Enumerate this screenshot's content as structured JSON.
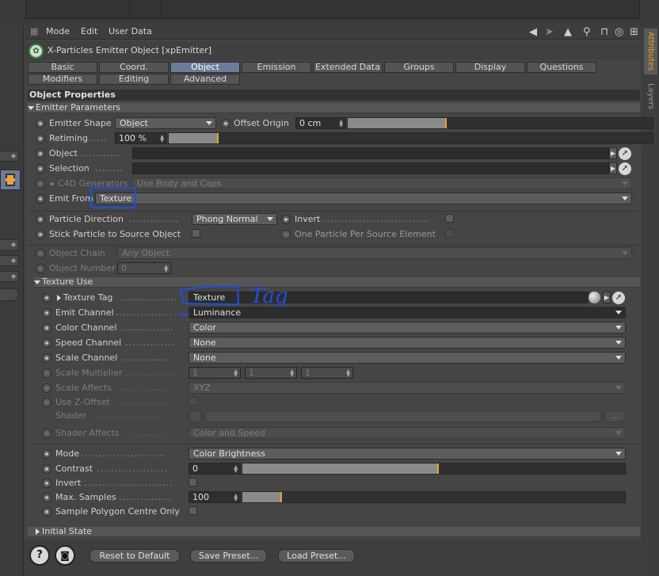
{
  "menu": {
    "mode": "Mode",
    "edit": "Edit",
    "user_data": "User Data"
  },
  "object_title": "X-Particles Emitter Object [xpEmitter]",
  "tabs_row1": [
    "Basic",
    "Coord.",
    "Object",
    "Emission",
    "Extended Data",
    "Groups",
    "Display",
    "Questions"
  ],
  "tabs_row2": [
    "Modifiers",
    "Editing",
    "Advanced"
  ],
  "active_tab": "Object",
  "side_tabs": {
    "attributes": "Attributes",
    "layers": "Layers"
  },
  "section_title": "Object Properties",
  "emitter_parameters": {
    "group_label": "Emitter Parameters",
    "emitter_shape_label": "Emitter Shape",
    "emitter_shape_value": "Object",
    "offset_origin_label": "Offset Origin",
    "offset_origin_value": "0 cm",
    "retiming_label": "Retiming",
    "retiming_value": "100 %",
    "object_label": "Object",
    "selection_label": "Selection",
    "c4d_generators_label": "C4D Generators",
    "c4d_generators_value": "Use Body and Caps",
    "emit_from_label": "Emit From",
    "emit_from_value": "Texture",
    "particle_direction_label": "Particle Direction",
    "particle_direction_value": "Phong Normal",
    "invert_label": "Invert",
    "stick_label": "Stick Particle to Source Object",
    "one_particle_label": "One Particle Per Source Element",
    "object_chain_label": "Object Chain",
    "object_chain_value": "Any Object",
    "object_number_label": "Object Number",
    "object_number_value": "0"
  },
  "texture_use": {
    "group_label": "Texture Use",
    "texture_tag_label": "Texture Tag",
    "texture_tag_value": "Texture",
    "emit_channel_label": "Emit Channel",
    "emit_channel_value": "Luminance",
    "color_channel_label": "Color Channel",
    "color_channel_value": "Color",
    "speed_channel_label": "Speed Channel",
    "speed_channel_value": "None",
    "scale_channel_label": "Scale Channel",
    "scale_channel_value": "None",
    "scale_multiplier_label": "Scale Multiplier",
    "scale_multiplier_values": [
      "1",
      "1",
      "1"
    ],
    "scale_affects_label": "Scale Affects",
    "scale_affects_value": "XYZ",
    "use_z_offset_label": "Use Z-Offset",
    "shader_label": "Shader",
    "shader_more": "...",
    "shader_affects_label": "Shader Affects",
    "shader_affects_value": "Color and Speed",
    "mode_label": "Mode",
    "mode_value": "Color Brightness",
    "contrast_label": "Contrast",
    "contrast_value": "0",
    "invert_label": "Invert",
    "max_samples_label": "Max. Samples",
    "max_samples_value": "100",
    "sample_polygon_label": "Sample Polygon Centre Only"
  },
  "initial_state_label": "Initial State",
  "buttons": {
    "reset": "Reset to Default",
    "save": "Save Preset...",
    "load": "Load Preset..."
  },
  "annotation": {
    "handwritten_text": "Tag",
    "color": "#1f4fe0"
  },
  "progress": {
    "offset_origin_fill_pct": 32,
    "retiming_fill_pct": 11,
    "contrast_fill_pct": 51,
    "max_samples_fill_pct": 10
  },
  "colors": {
    "accent": "#e9a51f",
    "active_tab": "#6a7c99"
  }
}
